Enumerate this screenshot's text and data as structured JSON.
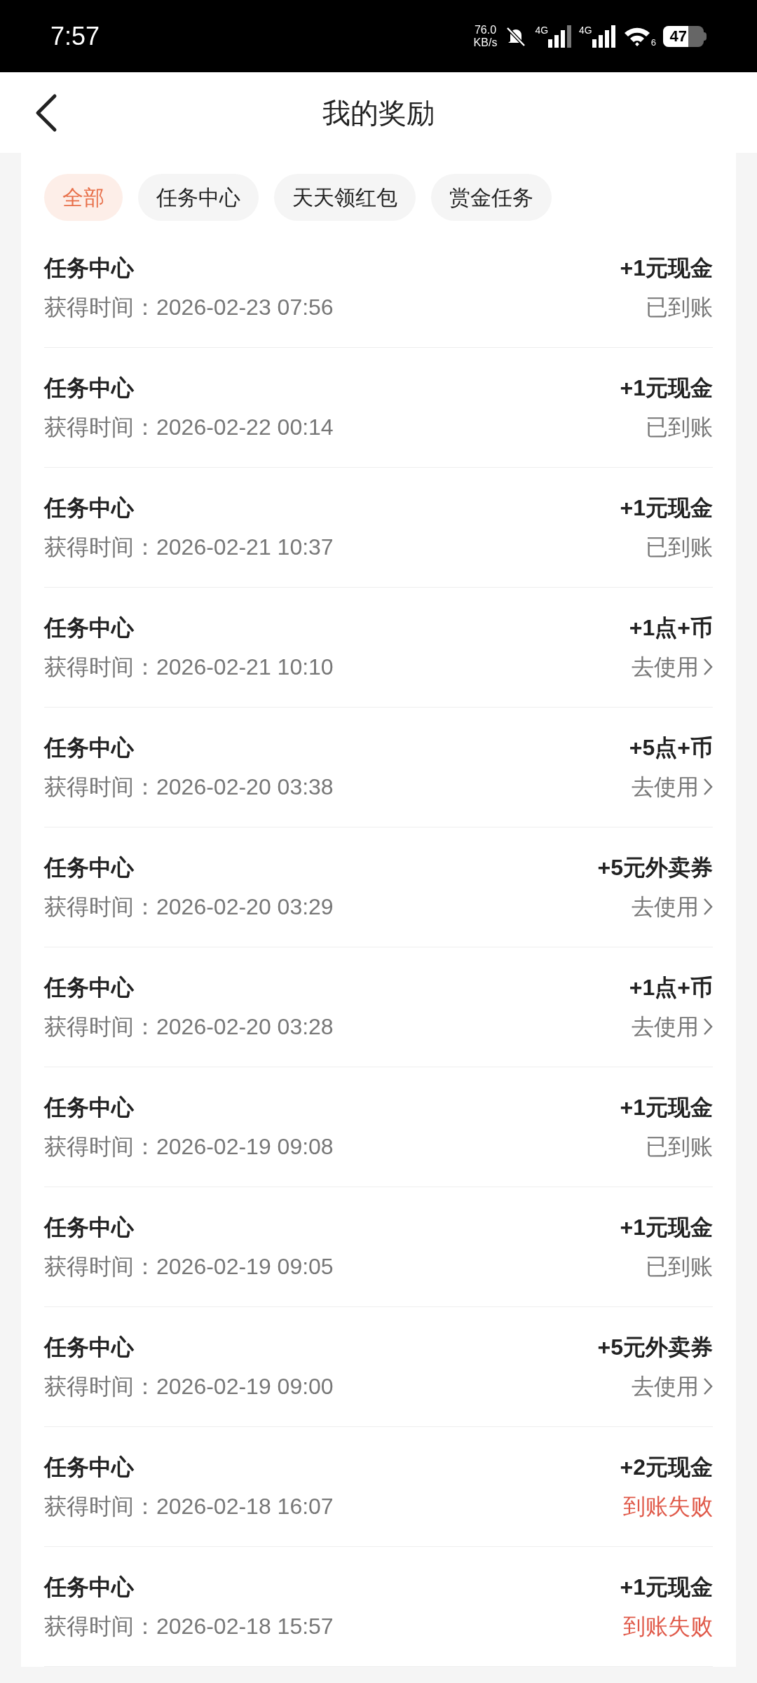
{
  "status_bar": {
    "time": "7:57",
    "net_speed": "76.0",
    "net_unit": "KB/s",
    "signal_1": "4G",
    "signal_2": "4G",
    "wifi_badge": "6",
    "battery": "47"
  },
  "header": {
    "title": "我的奖励"
  },
  "tabs": [
    {
      "label": "全部",
      "selected": true
    },
    {
      "label": "任务中心",
      "selected": false
    },
    {
      "label": "天天领红包",
      "selected": false
    },
    {
      "label": "赏金任务",
      "selected": false
    }
  ],
  "rewards": [
    {
      "source": "任务中心",
      "time": "获得时间：2026-02-23 07:56",
      "amount": "+1元现金",
      "status": "已到账",
      "kind": "credited"
    },
    {
      "source": "任务中心",
      "time": "获得时间：2026-02-22 00:14",
      "amount": "+1元现金",
      "status": "已到账",
      "kind": "credited"
    },
    {
      "source": "任务中心",
      "time": "获得时间：2026-02-21 10:37",
      "amount": "+1元现金",
      "status": "已到账",
      "kind": "credited"
    },
    {
      "source": "任务中心",
      "time": "获得时间：2026-02-21 10:10",
      "amount": "+1点+币",
      "status": "去使用",
      "kind": "use"
    },
    {
      "source": "任务中心",
      "time": "获得时间：2026-02-20 03:38",
      "amount": "+5点+币",
      "status": "去使用",
      "kind": "use"
    },
    {
      "source": "任务中心",
      "time": "获得时间：2026-02-20 03:29",
      "amount": "+5元外卖券",
      "status": "去使用",
      "kind": "use"
    },
    {
      "source": "任务中心",
      "time": "获得时间：2026-02-20 03:28",
      "amount": "+1点+币",
      "status": "去使用",
      "kind": "use"
    },
    {
      "source": "任务中心",
      "time": "获得时间：2026-02-19 09:08",
      "amount": "+1元现金",
      "status": "已到账",
      "kind": "credited"
    },
    {
      "source": "任务中心",
      "time": "获得时间：2026-02-19 09:05",
      "amount": "+1元现金",
      "status": "已到账",
      "kind": "credited"
    },
    {
      "source": "任务中心",
      "time": "获得时间：2026-02-19 09:00",
      "amount": "+5元外卖券",
      "status": "去使用",
      "kind": "use"
    },
    {
      "source": "任务中心",
      "time": "获得时间：2026-02-18 16:07",
      "amount": "+2元现金",
      "status": "到账失败",
      "kind": "failed"
    },
    {
      "source": "任务中心",
      "time": "获得时间：2026-02-18 15:57",
      "amount": "+1元现金",
      "status": "到账失败",
      "kind": "failed"
    }
  ]
}
